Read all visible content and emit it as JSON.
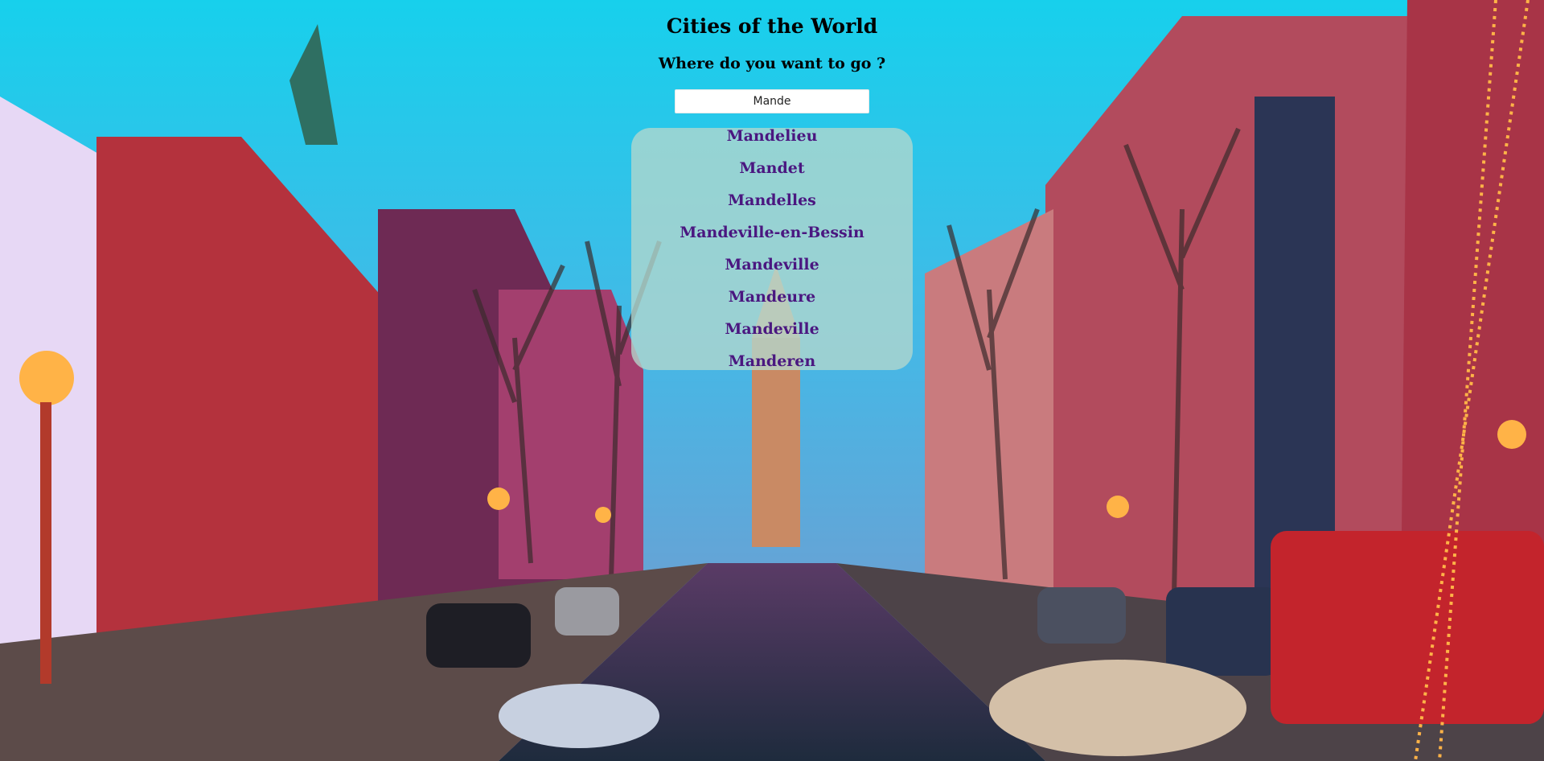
{
  "page": {
    "title": "Cities of the World",
    "subtitle": "Where do you want to go ?"
  },
  "search": {
    "value": "Mande"
  },
  "suggestions": [
    "Mandelieu",
    "Mandet",
    "Mandelles",
    "Mandeville-en-Bessin",
    "Mandeville",
    "Mandeure",
    "Mandeville",
    "Manderen"
  ],
  "colors": {
    "sky": "#27c6ea",
    "suggestion_text": "#4a1780",
    "suggestion_panel": "#b4d7cd"
  }
}
